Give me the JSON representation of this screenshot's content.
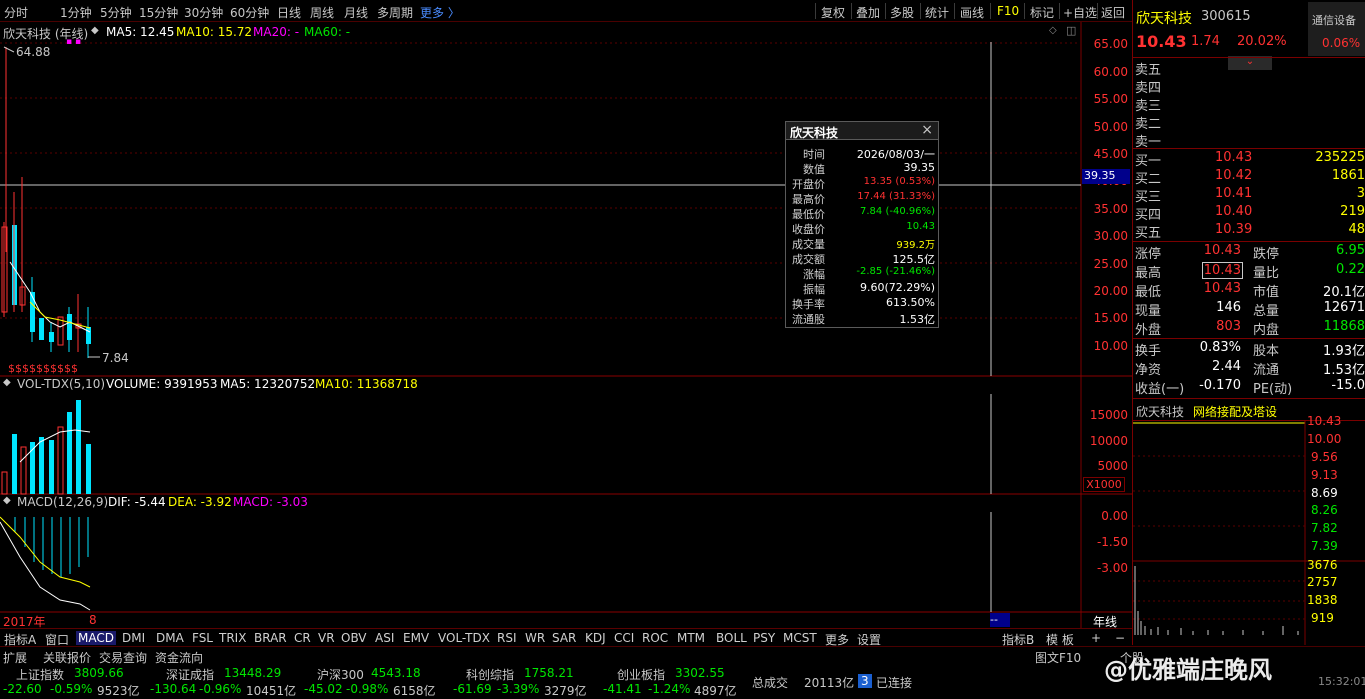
{
  "toolbar": {
    "periods": [
      "分时",
      "1分钟",
      "5分钟",
      "15分钟",
      "30分钟",
      "60分钟",
      "日线",
      "周线",
      "月线",
      "多周期",
      "更多 〉"
    ],
    "right_buttons": [
      "复权",
      "叠加",
      "多股",
      "统计",
      "画线",
      "F10",
      "标记",
      "+自选",
      "返回"
    ]
  },
  "main_chart": {
    "title": "欣天科技 (年线)",
    "ma_labels": {
      "ma5": "MA5: 12.45",
      "ma10": "MA10: 15.72",
      "ma20": "MA20: -",
      "ma60": "MA60: -"
    },
    "high_marker": "64.88",
    "low_marker": "7.84",
    "crosshair_value": "39.35",
    "year_label": "2017年",
    "year_tick": "8",
    "price_axis": [
      "65.00",
      "60.00",
      "55.00",
      "50.00",
      "45.00",
      "40.00",
      "35.00",
      "30.00",
      "25.00",
      "20.00",
      "15.00",
      "10.00"
    ],
    "divider_markers": "$$$$$$$$$$"
  },
  "volume_chart": {
    "title": "VOL-TDX(5,10)",
    "volume": "VOLUME: 9391953",
    "ma5": "MA5: 12320752",
    "ma10": "MA10: 11368718",
    "axis": [
      "15000",
      "10000",
      "5000"
    ],
    "unit": "X1000"
  },
  "macd_chart": {
    "title": "MACD(12,26,9)",
    "dif": "DIF: -5.44",
    "dea": "DEA: -3.92",
    "macd": "MACD: -3.03",
    "axis": [
      "0.00",
      "-1.50",
      "-3.00"
    ],
    "year_axis_label": "年线",
    "dashes": "--"
  },
  "tooltip": {
    "title": "欣天科技",
    "close_icon": "×",
    "rows": [
      {
        "k": "时间",
        "v": "2026/08/03/一",
        "c": "white"
      },
      {
        "k": "数值",
        "v": "39.35",
        "c": "white"
      },
      {
        "k": "开盘价",
        "v": "13.35 (0.53%)",
        "c": "red"
      },
      {
        "k": "最高价",
        "v": "17.44 (31.33%)",
        "c": "red"
      },
      {
        "k": "最低价",
        "v": "7.84 (-40.96%)",
        "c": "green"
      },
      {
        "k": "收盘价",
        "v": "10.43",
        "c": "green"
      },
      {
        "k": "成交量",
        "v": "939.2万",
        "c": "yel"
      },
      {
        "k": "成交额",
        "v": "125.5亿",
        "c": "white"
      },
      {
        "k": "涨幅",
        "v": "-2.85 (-21.46%)",
        "c": "green"
      },
      {
        "k": "振幅",
        "v": "9.60(72.29%)",
        "c": "white"
      },
      {
        "k": "换手率",
        "v": "613.50%",
        "c": "white"
      },
      {
        "k": "流通股",
        "v": "1.53亿",
        "c": "white"
      }
    ]
  },
  "right_panel": {
    "name": "欣天科技",
    "code": "300615",
    "price": "10.43",
    "change": "1.74",
    "change_pct": "20.02%",
    "sector": "通信设备",
    "sector_pct": "0.06%",
    "sell": [
      {
        "label": "卖五",
        "price": "",
        "vol": ""
      },
      {
        "label": "卖四",
        "price": "",
        "vol": ""
      },
      {
        "label": "卖三",
        "price": "",
        "vol": ""
      },
      {
        "label": "卖二",
        "price": "",
        "vol": ""
      },
      {
        "label": "卖一",
        "price": "",
        "vol": ""
      }
    ],
    "buy": [
      {
        "label": "买一",
        "price": "10.43",
        "vol": "235225"
      },
      {
        "label": "买二",
        "price": "10.42",
        "vol": "1861"
      },
      {
        "label": "买三",
        "price": "10.41",
        "vol": "3"
      },
      {
        "label": "买四",
        "price": "10.40",
        "vol": "219"
      },
      {
        "label": "买五",
        "price": "10.39",
        "vol": "48"
      }
    ],
    "stats1": [
      {
        "k1": "涨停",
        "v1": "10.43",
        "c1": "red",
        "k2": "跌停",
        "v2": "6.95",
        "c2": "green"
      },
      {
        "k1": "最高",
        "v1": "10.43",
        "c1": "red",
        "k2": "量比",
        "v2": "0.22",
        "c2": "green"
      },
      {
        "k1": "最低",
        "v1": "10.43",
        "c1": "red",
        "k2": "市值",
        "v2": "20.1亿",
        "c2": "white"
      },
      {
        "k1": "现量",
        "v1": "146",
        "c1": "white",
        "k2": "总量",
        "v2": "12671",
        "c2": "white"
      },
      {
        "k1": "外盘",
        "v1": "803",
        "c1": "red",
        "k2": "内盘",
        "v2": "11868",
        "c2": "green"
      }
    ],
    "stats2": [
      {
        "k1": "换手",
        "v1": "0.83%",
        "k2": "股本",
        "v2": "1.93亿"
      },
      {
        "k1": "净资",
        "v1": "2.44",
        "k2": "流通",
        "v2": "1.53亿"
      },
      {
        "k1": "收益(一)",
        "v1": "-0.170",
        "k2": "PE(动)",
        "v2": "-15.0"
      }
    ],
    "mini_title": "欣天科技",
    "mini_tag": "网络接配及塔设",
    "mini_price_axis": [
      "10.43",
      "10.00",
      "9.56",
      "9.13",
      "8.69",
      "8.26",
      "7.82",
      "7.39"
    ],
    "mini_vol_axis": [
      "3676",
      "2757",
      "1838",
      "919"
    ]
  },
  "tabs": [
    "指标A",
    "窗口",
    "MACD",
    "DMI",
    "DMA",
    "FSL",
    "TRIX",
    "BRAR",
    "CR",
    "VR",
    "OBV",
    "ASI",
    "EMV",
    "VOL-TDX",
    "RSI",
    "WR",
    "SAR",
    "KDJ",
    "CCI",
    "ROC",
    "MTM",
    "BOLL",
    "PSY",
    "MCST",
    "更多",
    "设置"
  ],
  "tabs_right": [
    "指标B",
    "模 板",
    "+",
    "−"
  ],
  "bottom": {
    "left_tabs": [
      "扩展",
      "关联报价",
      "交易查询",
      "资金流向"
    ],
    "indices": [
      {
        "name": "上证指数",
        "val": "3809.66",
        "chg": "-22.60",
        "pct": "-0.59%",
        "amt": "9523亿"
      },
      {
        "name": "深证成指",
        "val": "13448.29",
        "chg": "-130.64",
        "pct": "-0.96%",
        "amt": "10451亿"
      },
      {
        "name": "沪深300",
        "val": "4543.18",
        "chg": "-45.02",
        "pct": "-0.98%",
        "amt": "6158亿"
      },
      {
        "name": "科创综指",
        "val": "1758.21",
        "chg": "-61.69",
        "pct": "-3.39%",
        "amt": "3279亿"
      },
      {
        "name": "创业板指",
        "val": "3302.55",
        "chg": "-41.41",
        "pct": "-1.24%",
        "amt": "4897亿"
      }
    ],
    "total_label": "总成交",
    "total_val": "20113亿",
    "conn_num": "3",
    "conn_label": "已连接",
    "right_items": [
      "图文F10",
      "个股"
    ],
    "time": "15:32:01",
    "watermark": "@优雅端庄晚风"
  }
}
